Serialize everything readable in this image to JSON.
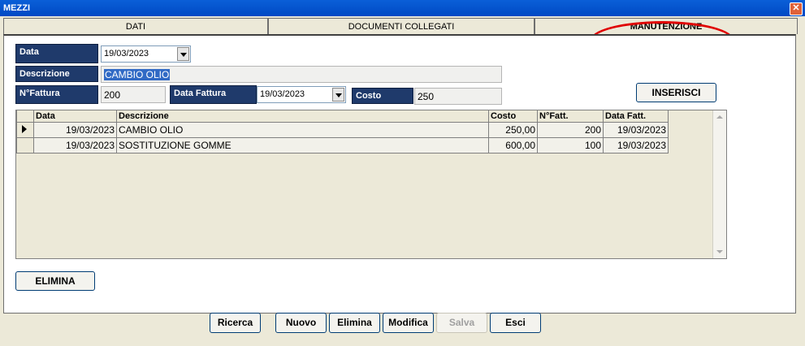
{
  "window": {
    "title": "MEZZI",
    "close": "✕"
  },
  "tabs": [
    "DATI",
    "DOCUMENTI COLLEGATI",
    "MANUTENZIONE"
  ],
  "form": {
    "data_label": "Data",
    "data_value": "19/03/2023",
    "descrizione_label": "Descrizione",
    "descrizione_value": "CAMBIO OLIO",
    "nfattura_label": "N°Fattura",
    "nfattura_value": "200",
    "datafattura_label": "Data Fattura",
    "datafattura_value": "19/03/2023",
    "costo_label": "Costo",
    "costo_value": "250",
    "inserisci": "INSERISCI",
    "elimina": "ELIMINA"
  },
  "grid": {
    "headers": [
      "Data",
      "Descrizione",
      "Costo",
      "N°Fatt.",
      "Data Fatt."
    ],
    "rows": [
      [
        "19/03/2023",
        "CAMBIO OLIO",
        "250,00",
        "200",
        "19/03/2023"
      ],
      [
        "19/03/2023",
        "SOSTITUZIONE GOMME",
        "600,00",
        "100",
        "19/03/2023"
      ]
    ]
  },
  "bottom": {
    "ricerca": "Ricerca",
    "nuovo": "Nuovo",
    "elimina": "Elimina",
    "modifica": "Modifica",
    "salva": "Salva",
    "esci": "Esci"
  }
}
